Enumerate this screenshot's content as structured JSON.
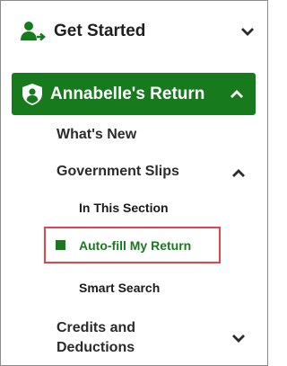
{
  "nav": {
    "get_started": {
      "label": "Get Started",
      "icon": "person-arrow-icon"
    },
    "return": {
      "label": "Annabelle's Return",
      "icon": "shield-user-icon"
    },
    "items": {
      "whats_new": "What's New",
      "government_slips": "Government Slips",
      "credits_deductions": "Credits and Deductions"
    },
    "sub_items": {
      "in_this_section": "In This Section",
      "autofill": "Auto-fill My Return",
      "smart_search": "Smart Search"
    }
  },
  "colors": {
    "accent_green": "#177b1e",
    "highlight_red": "#e3434c",
    "text_dark": "#1f1f1f"
  }
}
